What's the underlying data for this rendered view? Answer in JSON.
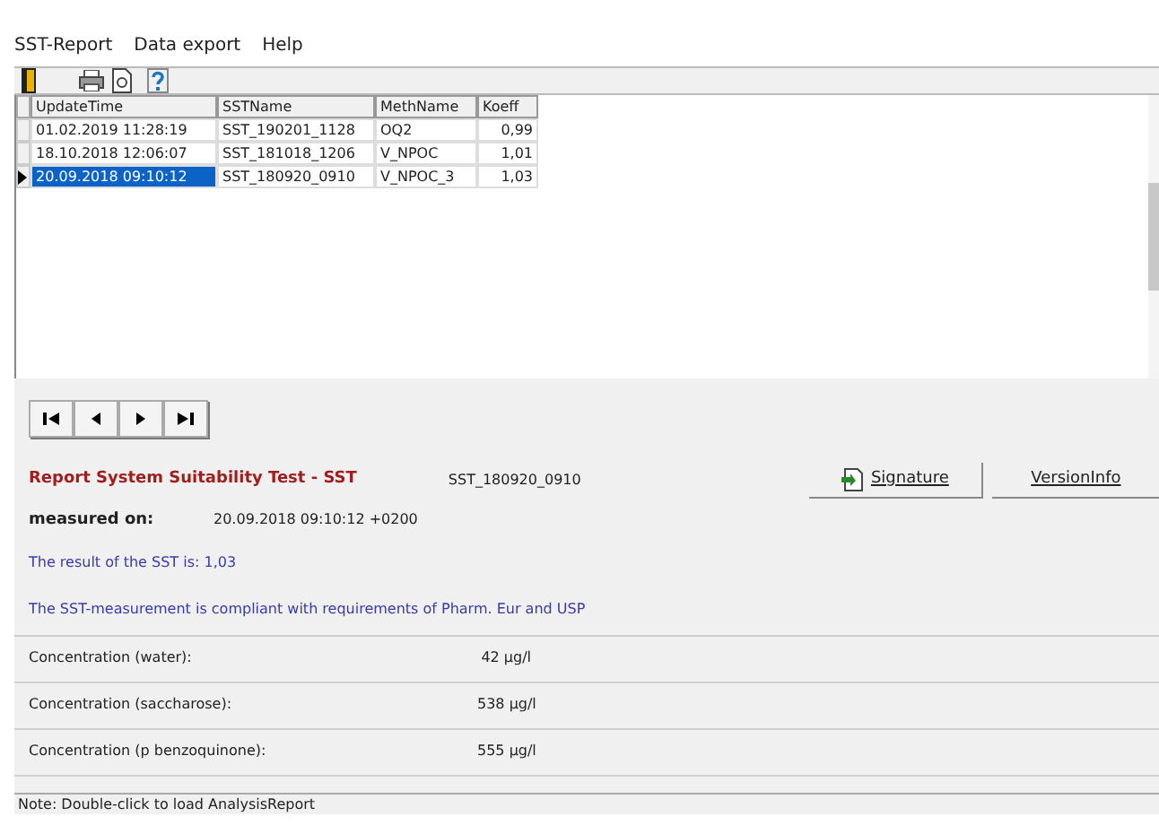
{
  "menu": [
    "SST-Report",
    "Data export",
    "Help"
  ],
  "table": {
    "columns": [
      "UpdateTime",
      "SSTName",
      "MethName",
      "Koeff"
    ],
    "rows": [
      {
        "cells": [
          "01.02.2019 11:28:19",
          "SST_190201_1128",
          "OQ2",
          "0,99"
        ],
        "selected": false
      },
      {
        "cells": [
          "18.10.2018 12:06:07",
          "SST_181018_1206",
          "V_NPOC",
          "1,01"
        ],
        "selected": false
      },
      {
        "cells": [
          "20.09.2018 09:10:12",
          "SST_180920_0910",
          "V_NPOC_3",
          "1,03"
        ],
        "selected": true
      }
    ]
  },
  "report": {
    "title": "Report System Suitability Test - SST",
    "sst_name": "SST_180920_0910",
    "measured_label": "measured on:",
    "measured_value": "20.09.2018 09:10:12 +0200",
    "result": "The result of the SST is: 1,03",
    "compliance": "The SST-measurement is compliant with requirements of Pharm. Eur and USP",
    "buttons": [
      "Signature",
      "VersionInfo"
    ]
  },
  "concentrations": [
    {
      "label": "Concentration (water):",
      "value": "42 µg/l"
    },
    {
      "label": "Concentration (saccharose):",
      "value": "538 µg/l"
    },
    {
      "label": "Concentration (p benzoquinone):",
      "value": "555 µg/l"
    }
  ],
  "status_bar": "Note: Double-click to load AnalysisReport"
}
